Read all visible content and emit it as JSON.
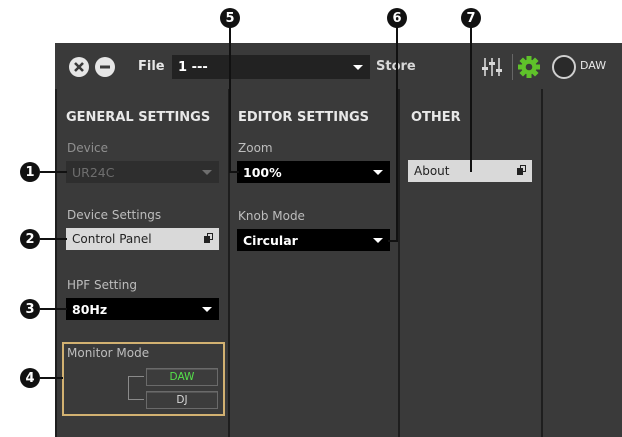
{
  "toolbar": {
    "file_label": "File",
    "preset_value": "1  ---",
    "store_label": "Store",
    "daw_label": "DAW"
  },
  "general": {
    "heading": "GENERAL SETTINGS",
    "device_label": "Device",
    "device_value": "UR24C",
    "device_settings_label": "Device Settings",
    "control_panel_label": "Control Panel",
    "hpf_label": "HPF Setting",
    "hpf_value": "80Hz",
    "monitor_mode_label": "Monitor Mode",
    "monitor_daw": "DAW",
    "monitor_dj": "DJ"
  },
  "editor": {
    "heading": "EDITOR SETTINGS",
    "zoom_label": "Zoom",
    "zoom_value": "100%",
    "knob_mode_label": "Knob Mode",
    "knob_mode_value": "Circular"
  },
  "other": {
    "heading": "OTHER",
    "about_label": "About"
  },
  "callouts": [
    "1",
    "2",
    "3",
    "4",
    "5",
    "6",
    "7"
  ],
  "colors": {
    "panel": "#3a3a3a",
    "active_green": "#55e04a",
    "gear_green": "#5fc22a"
  }
}
